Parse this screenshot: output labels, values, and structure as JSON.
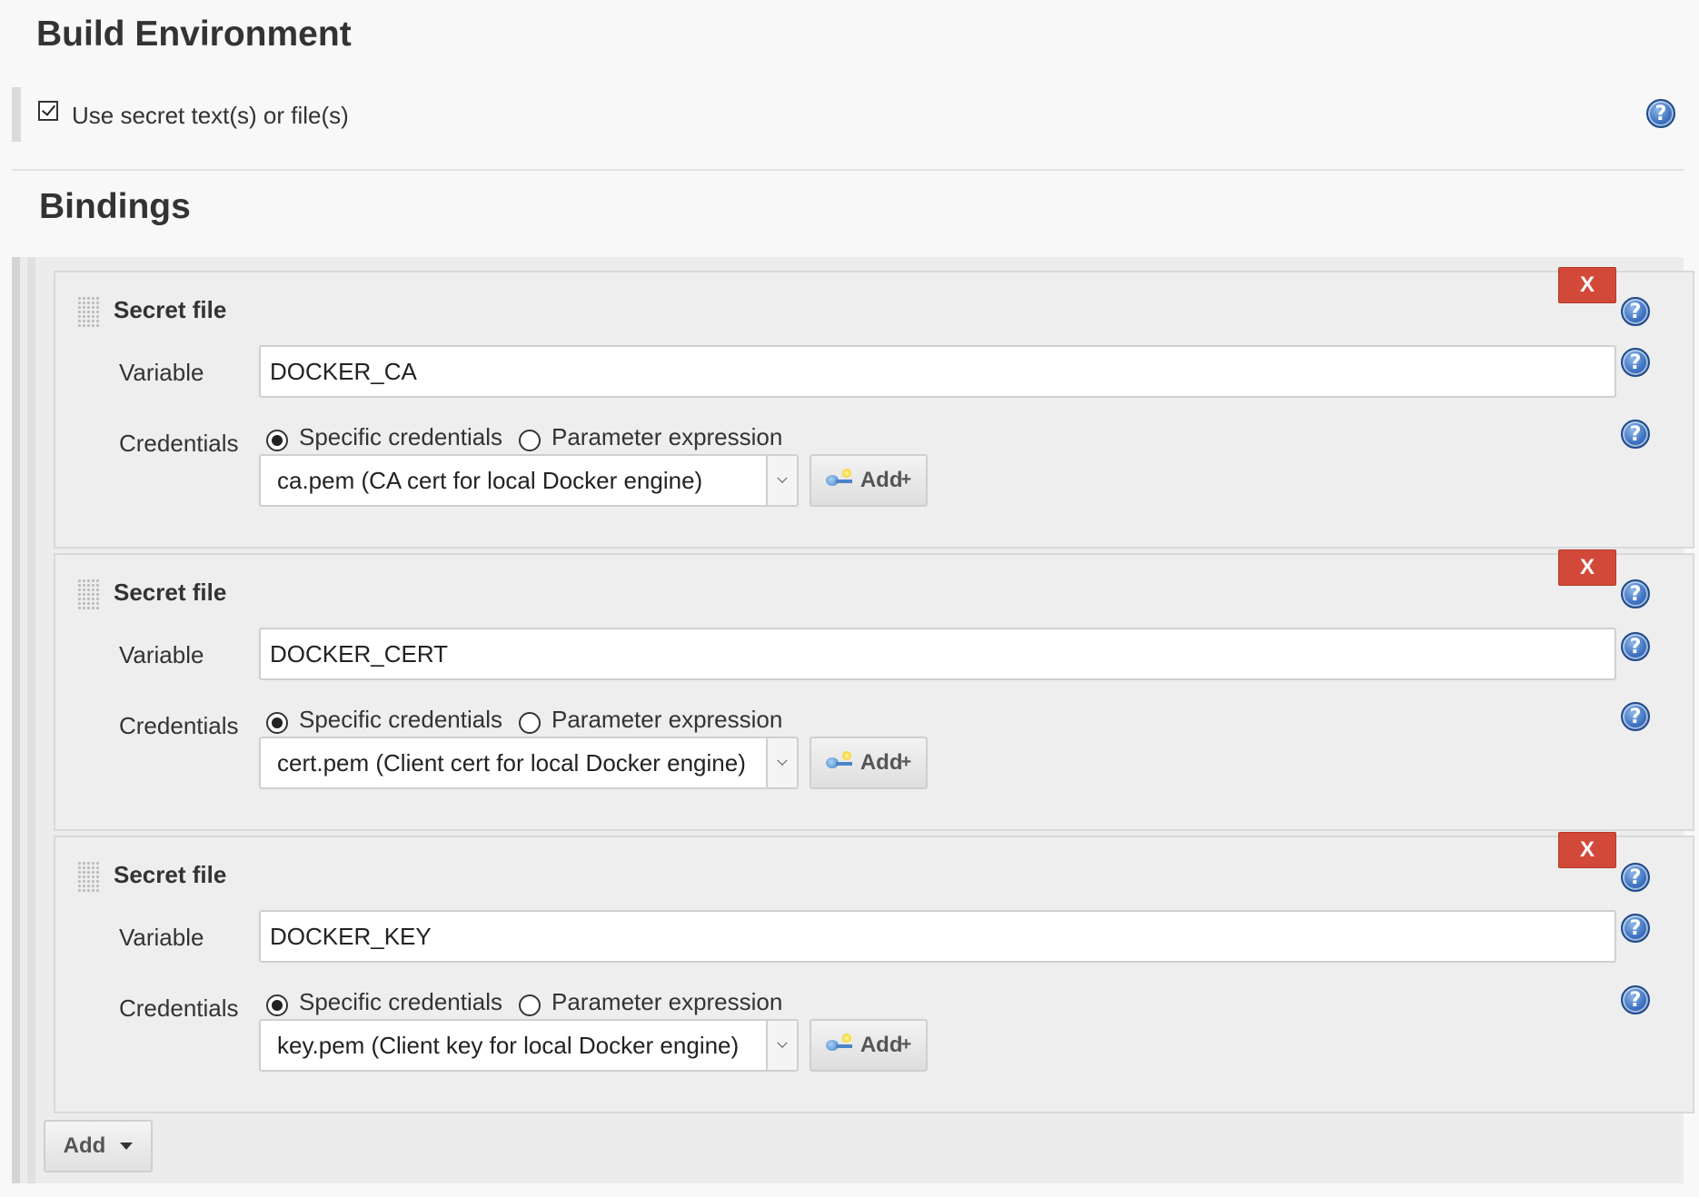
{
  "build_environment": {
    "title": "Build Environment",
    "use_secret": {
      "label": "Use secret text(s) or file(s)",
      "checked": true
    }
  },
  "bindings": {
    "title": "Bindings",
    "items": [
      {
        "type_label": "Secret file",
        "delete_label": "X",
        "variable_label": "Variable",
        "variable_value": "DOCKER_CA",
        "credentials_label": "Credentials",
        "radio_specific": "Specific credentials",
        "radio_parameter": "Parameter expression",
        "selected_mode": "specific",
        "credential_value": "ca.pem (CA cert for local Docker engine)",
        "add_label": "Add"
      },
      {
        "type_label": "Secret file",
        "delete_label": "X",
        "variable_label": "Variable",
        "variable_value": "DOCKER_CERT",
        "credentials_label": "Credentials",
        "radio_specific": "Specific credentials",
        "radio_parameter": "Parameter expression",
        "selected_mode": "specific",
        "credential_value": "cert.pem (Client cert for local Docker engine)",
        "add_label": "Add"
      },
      {
        "type_label": "Secret file",
        "delete_label": "X",
        "variable_label": "Variable",
        "variable_value": "DOCKER_KEY",
        "credentials_label": "Credentials",
        "radio_specific": "Specific credentials",
        "radio_parameter": "Parameter expression",
        "selected_mode": "specific",
        "credential_value": "key.pem (Client key for local Docker engine)",
        "add_label": "Add"
      }
    ],
    "add_button_label": "Add"
  },
  "icons": {
    "help": "help-icon",
    "help_glyph": "?",
    "key": "key-icon",
    "drag": "drag-handle-icon",
    "dropdown": "chevron-down-icon"
  },
  "colors": {
    "delete_red": "#d24939",
    "help_blue": "#3f74c2"
  }
}
